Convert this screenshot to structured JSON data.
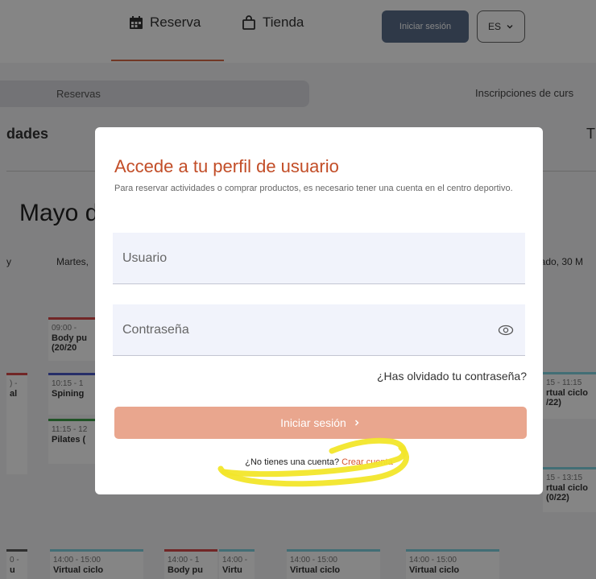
{
  "topnav": {
    "reserva_label": "Reserva",
    "tienda_label": "Tienda",
    "login_label": "Iniciar sesión",
    "lang_label": "ES"
  },
  "tabs": {
    "reservas_label": "Reservas",
    "inscripciones_label": "Inscripciones de curs"
  },
  "section": {
    "title": "dades",
    "right_letter": "T"
  },
  "calendar": {
    "month": "Mayo de",
    "day_headers": [
      "y",
      "Martes,",
      "bado, 30 M"
    ],
    "cards": [
      {
        "time": "09:00 -",
        "name": "Body pu (20/20"
      },
      {
        "time": "10:15 - 1",
        "name": "Spining"
      },
      {
        "time": "11:15 - 12",
        "name": "Pilates ("
      },
      {
        "time": ") -",
        "name": "al"
      },
      {
        "time": "15 - 11:15",
        "name": "rtual ciclo /22)"
      },
      {
        "time": "15 - 13:15",
        "name": "rtual ciclo (0/22)"
      },
      {
        "time": "0 -",
        "name": "u"
      },
      {
        "time": "14:00 - 15:00",
        "name": "Virtual ciclo"
      },
      {
        "time": "14:00 - 1",
        "name": "Body pu"
      },
      {
        "time": "14:00 -",
        "name": "Virtu"
      },
      {
        "time": "14:00 - 15:00",
        "name": "Virtual ciclo"
      },
      {
        "time": "14:00 - 15:00",
        "name": "Virtual ciclo"
      }
    ]
  },
  "modal": {
    "title": "Accede a tu perfil de usuario",
    "description": "Para reservar actividades o comprar productos, es necesario tener una cuenta en el centro deportivo.",
    "username_placeholder": "Usuario",
    "password_placeholder": "Contraseña",
    "forgot_label": "¿Has olvidado tu contraseña?",
    "login_button_label": "Iniciar sesión",
    "no_account_text": "¿No tienes una cuenta?",
    "create_account_label": "Crear cuenta"
  },
  "colors": {
    "accent": "#c24d27",
    "button": "#e9a68e",
    "highlight": "#f2e62a"
  },
  "icons": {
    "reserva": "calendar-icon",
    "tienda": "shopping-bag-icon",
    "password": "eye-icon",
    "chevron": "chevron-right-icon"
  }
}
